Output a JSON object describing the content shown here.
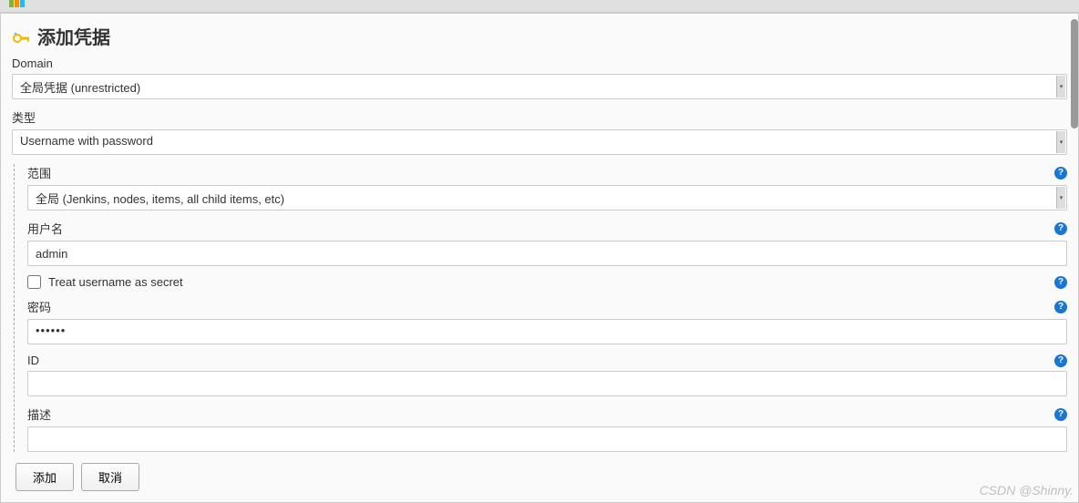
{
  "page": {
    "title": "添加凭据"
  },
  "fields": {
    "domain": {
      "label": "Domain",
      "value": "全局凭据 (unrestricted)"
    },
    "kind": {
      "label": "类型",
      "value": "Username with password"
    },
    "scope": {
      "label": "范围",
      "value": "全局 (Jenkins, nodes, items, all child items, etc)"
    },
    "username": {
      "label": "用户名",
      "value": "admin"
    },
    "treat_secret": {
      "label": "Treat username as secret",
      "checked": false
    },
    "password": {
      "label": "密码",
      "value_masked": "••••••"
    },
    "id": {
      "label": "ID",
      "value": ""
    },
    "description": {
      "label": "描述",
      "value": ""
    }
  },
  "buttons": {
    "add": "添加",
    "cancel": "取消"
  },
  "watermark": "CSDN @Shinny."
}
